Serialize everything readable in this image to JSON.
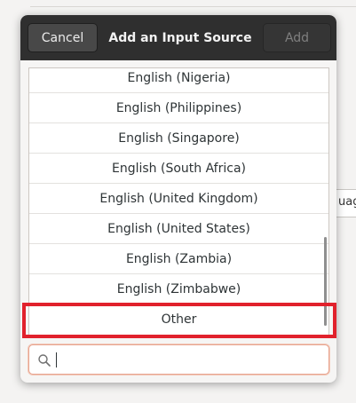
{
  "background": {
    "field_text": "uag"
  },
  "dialog": {
    "title": "Add an Input Source",
    "cancel_label": "Cancel",
    "add_label": "Add",
    "items": [
      {
        "label": "English (Nigeria)"
      },
      {
        "label": "English (Philippines)"
      },
      {
        "label": "English (Singapore)"
      },
      {
        "label": "English (South Africa)"
      },
      {
        "label": "English (United Kingdom)"
      },
      {
        "label": "English (United States)"
      },
      {
        "label": "English (Zambia)"
      },
      {
        "label": "English (Zimbabwe)"
      },
      {
        "label": "Other"
      }
    ],
    "highlighted_item": "Other",
    "highlight_color": "#e1212c",
    "search": {
      "value": "",
      "placeholder": ""
    }
  }
}
